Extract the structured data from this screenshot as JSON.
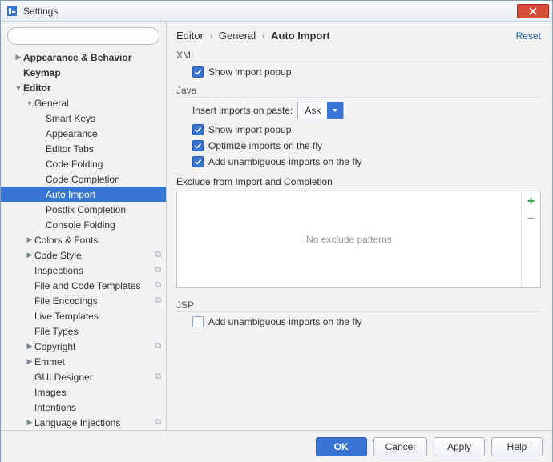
{
  "window": {
    "title": "Settings"
  },
  "search": {
    "placeholder": ""
  },
  "header": {
    "crumb1": "Editor",
    "crumb2": "General",
    "crumb3": "Auto Import",
    "reset": "Reset"
  },
  "sidebar": {
    "items": [
      {
        "label": "Appearance & Behavior",
        "depth": 0,
        "arrow": "right",
        "bold": true
      },
      {
        "label": "Keymap",
        "depth": 0,
        "arrow": "",
        "bold": true
      },
      {
        "label": "Editor",
        "depth": 0,
        "arrow": "down",
        "bold": true
      },
      {
        "label": "General",
        "depth": 1,
        "arrow": "down",
        "bold": false
      },
      {
        "label": "Smart Keys",
        "depth": 2,
        "arrow": "",
        "bold": false
      },
      {
        "label": "Appearance",
        "depth": 2,
        "arrow": "",
        "bold": false
      },
      {
        "label": "Editor Tabs",
        "depth": 2,
        "arrow": "",
        "bold": false
      },
      {
        "label": "Code Folding",
        "depth": 2,
        "arrow": "",
        "bold": false
      },
      {
        "label": "Code Completion",
        "depth": 2,
        "arrow": "",
        "bold": false
      },
      {
        "label": "Auto Import",
        "depth": 2,
        "arrow": "",
        "bold": false,
        "selected": true
      },
      {
        "label": "Postfix Completion",
        "depth": 2,
        "arrow": "",
        "bold": false
      },
      {
        "label": "Console Folding",
        "depth": 2,
        "arrow": "",
        "bold": false
      },
      {
        "label": "Colors & Fonts",
        "depth": 1,
        "arrow": "right",
        "bold": false
      },
      {
        "label": "Code Style",
        "depth": 1,
        "arrow": "right",
        "bold": false,
        "copy": true
      },
      {
        "label": "Inspections",
        "depth": 1,
        "arrow": "",
        "bold": false,
        "copy": true
      },
      {
        "label": "File and Code Templates",
        "depth": 1,
        "arrow": "",
        "bold": false,
        "copy": true
      },
      {
        "label": "File Encodings",
        "depth": 1,
        "arrow": "",
        "bold": false,
        "copy": true
      },
      {
        "label": "Live Templates",
        "depth": 1,
        "arrow": "",
        "bold": false
      },
      {
        "label": "File Types",
        "depth": 1,
        "arrow": "",
        "bold": false
      },
      {
        "label": "Copyright",
        "depth": 1,
        "arrow": "right",
        "bold": false,
        "copy": true
      },
      {
        "label": "Emmet",
        "depth": 1,
        "arrow": "right",
        "bold": false
      },
      {
        "label": "GUI Designer",
        "depth": 1,
        "arrow": "",
        "bold": false,
        "copy": true
      },
      {
        "label": "Images",
        "depth": 1,
        "arrow": "",
        "bold": false
      },
      {
        "label": "Intentions",
        "depth": 1,
        "arrow": "",
        "bold": false
      },
      {
        "label": "Language Injections",
        "depth": 1,
        "arrow": "right",
        "bold": false,
        "copy": true
      }
    ]
  },
  "sections": {
    "xml": {
      "title": "XML",
      "show_popup": "Show import popup"
    },
    "java": {
      "title": "Java",
      "insert_label": "Insert imports on paste:",
      "insert_value": "Ask",
      "show_popup": "Show import popup",
      "optimize": "Optimize imports on the fly",
      "unambiguous": "Add unambiguous imports on the fly",
      "exclude_title": "Exclude from Import and Completion",
      "exclude_empty": "No exclude patterns"
    },
    "jsp": {
      "title": "JSP",
      "unambiguous": "Add unambiguous imports on the fly"
    }
  },
  "footer": {
    "ok": "OK",
    "cancel": "Cancel",
    "apply": "Apply",
    "help": "Help"
  }
}
